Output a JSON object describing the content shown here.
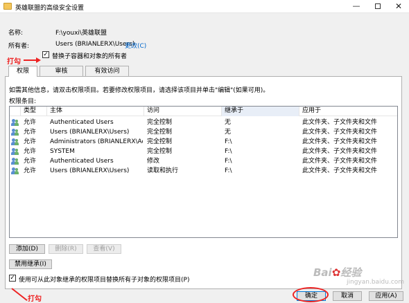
{
  "window": {
    "title": "英雄联盟的高级安全设置",
    "min_glyph": "—",
    "close_glyph": "✕"
  },
  "info": {
    "name_label": "名称:",
    "name_value": "F:\\youxi\\英雄联盟",
    "owner_label": "所有者:",
    "owner_value": "Users (BRIANLERX\\Users)",
    "change_link": "更改(C)",
    "replace_owner_label": "替换子容器和对象的所有者",
    "replace_owner_checked": true
  },
  "annotations": {
    "top": "打勾",
    "bottom": "打勾"
  },
  "tabs": [
    {
      "label": "权限",
      "active": true
    },
    {
      "label": "审核",
      "active": false
    },
    {
      "label": "有效访问",
      "active": false
    }
  ],
  "panel": {
    "instruction": "如需其他信息，请双击权限项目。若要修改权限项目，请选择该项目并单击\"编辑\"(如果可用)。",
    "entries_label": "权限条目:"
  },
  "table": {
    "columns": [
      "类型",
      "主体",
      "访问",
      "继承于",
      "应用于"
    ],
    "rows": [
      [
        "允许",
        "Authenticated Users",
        "完全控制",
        "无",
        "此文件夹、子文件夹和文件"
      ],
      [
        "允许",
        "Users (BRIANLERX\\Users)",
        "完全控制",
        "无",
        "此文件夹、子文件夹和文件"
      ],
      [
        "允许",
        "Administrators (BRIANLERX\\Ad...",
        "完全控制",
        "F:\\",
        "此文件夹、子文件夹和文件"
      ],
      [
        "允许",
        "SYSTEM",
        "完全控制",
        "F:\\",
        "此文件夹、子文件夹和文件"
      ],
      [
        "允许",
        "Authenticated Users",
        "修改",
        "F:\\",
        "此文件夹、子文件夹和文件"
      ],
      [
        "允许",
        "Users (BRIANLERX\\Users)",
        "读取和执行",
        "F:\\",
        "此文件夹、子文件夹和文件"
      ]
    ]
  },
  "buttons": {
    "add": "添加(D)",
    "remove": "删除(R)",
    "view": "查看(V)",
    "disable_inheritance": "禁用继承(I)",
    "replace_child_label": "使用可从此对象继承的权限项目替换所有子对象的权限项目(P)",
    "replace_child_checked": true,
    "ok": "确定",
    "cancel": "取消",
    "apply": "应用(A)"
  },
  "watermark": {
    "text": "Bai",
    "paw": "✿",
    "tail": "经验",
    "sub": "jingyan.baidu.com"
  }
}
